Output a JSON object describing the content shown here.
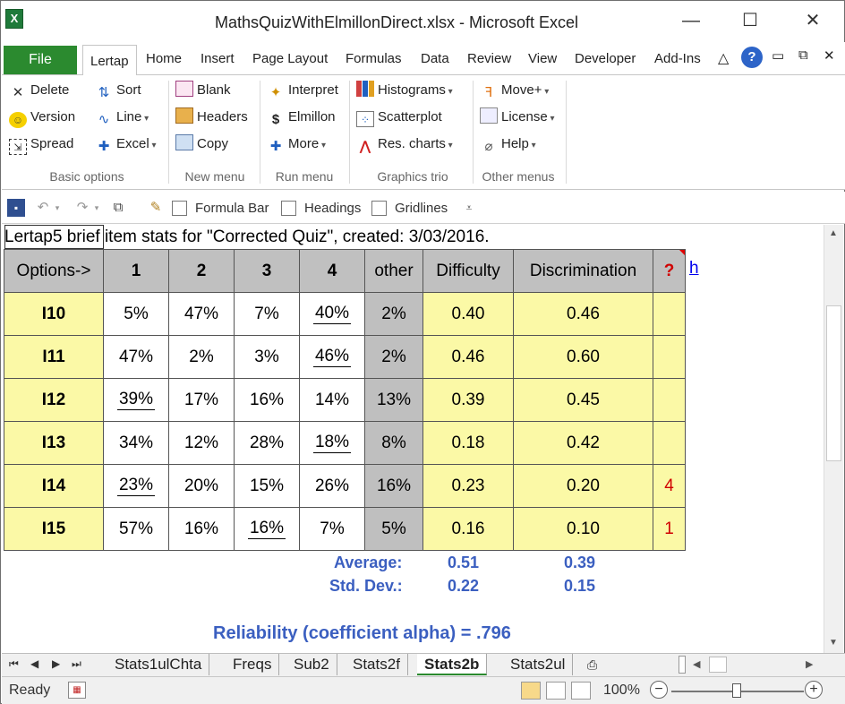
{
  "window": {
    "title": "MathsQuizWithElmillonDirect.xlsx  -  Microsoft Excel",
    "app_icon": "X",
    "minimize": "—",
    "maximize": "☐",
    "close": "✕"
  },
  "ribbon_tabs": {
    "file": "File",
    "lertap": "Lertap",
    "others": [
      "Home",
      "Insert",
      "Page Layout",
      "Formulas",
      "Data",
      "Review",
      "View",
      "Developer",
      "Add-Ins"
    ]
  },
  "ribbon": {
    "basic": {
      "delete": "Delete",
      "version": "Version",
      "spread": "Spread",
      "sort": "Sort",
      "line": "Line",
      "excel": "Excel",
      "label": "Basic options"
    },
    "new_menu": {
      "blank": "Blank",
      "headers": "Headers",
      "copy": "Copy",
      "label": "New menu"
    },
    "run_menu": {
      "interpret": "Interpret",
      "elmillon": "Elmillon",
      "more": "More",
      "label": "Run menu"
    },
    "graphics": {
      "histograms": "Histograms",
      "scatterplot": "Scatterplot",
      "res_charts": "Res. charts",
      "label": "Graphics trio"
    },
    "other": {
      "move": "Move+",
      "license": "License",
      "help": "Help",
      "label": "Other menus"
    }
  },
  "qat": {
    "formula_bar": "Formula Bar",
    "headings": "Headings",
    "gridlines": "Gridlines"
  },
  "sheet": {
    "caption": "Lertap5 brief item stats for \"Corrected Quiz\", created: 3/03/2016.",
    "headers": [
      "Options->",
      "1",
      "2",
      "3",
      "4",
      "other",
      "Difficulty",
      "Discrimination",
      "?"
    ],
    "hyperlink": "h",
    "rows": [
      {
        "item": "I10",
        "o1": "5%",
        "o2": "47%",
        "o3": "7%",
        "o4": "40%",
        "other": "2%",
        "diff": "0.40",
        "disc": "0.46",
        "flag": ""
      },
      {
        "item": "I11",
        "o1": "47%",
        "o2": "2%",
        "o3": "3%",
        "o4": "46%",
        "other": "2%",
        "diff": "0.46",
        "disc": "0.60",
        "flag": ""
      },
      {
        "item": "I12",
        "o1": "39%",
        "o2": "17%",
        "o3": "16%",
        "o4": "14%",
        "other": "13%",
        "diff": "0.39",
        "disc": "0.45",
        "flag": ""
      },
      {
        "item": "I13",
        "o1": "34%",
        "o2": "12%",
        "o3": "28%",
        "o4": "18%",
        "other": "8%",
        "diff": "0.18",
        "disc": "0.42",
        "flag": ""
      },
      {
        "item": "I14",
        "o1": "23%",
        "o2": "20%",
        "o3": "15%",
        "o4": "26%",
        "other": "16%",
        "diff": "0.23",
        "disc": "0.20",
        "flag": "4"
      },
      {
        "item": "I15",
        "o1": "57%",
        "o2": "16%",
        "o3": "16%",
        "o4": "7%",
        "other": "5%",
        "diff": "0.16",
        "disc": "0.10",
        "flag": "1"
      }
    ],
    "summary": {
      "average_label": "Average:",
      "average_diff": "0.51",
      "average_disc": "0.39",
      "sd_label": "Std. Dev.:",
      "sd_diff": "0.22",
      "sd_disc": "0.15",
      "reliability": "Reliability (coefficient alpha) =  .796"
    }
  },
  "sheet_tabs": [
    "Stats1ulChta",
    "Freqs",
    "Sub2",
    "Stats2f",
    "Stats2b",
    "Stats2ul"
  ],
  "active_sheet": "Stats2b",
  "status": {
    "ready": "Ready",
    "zoom": "100%"
  }
}
